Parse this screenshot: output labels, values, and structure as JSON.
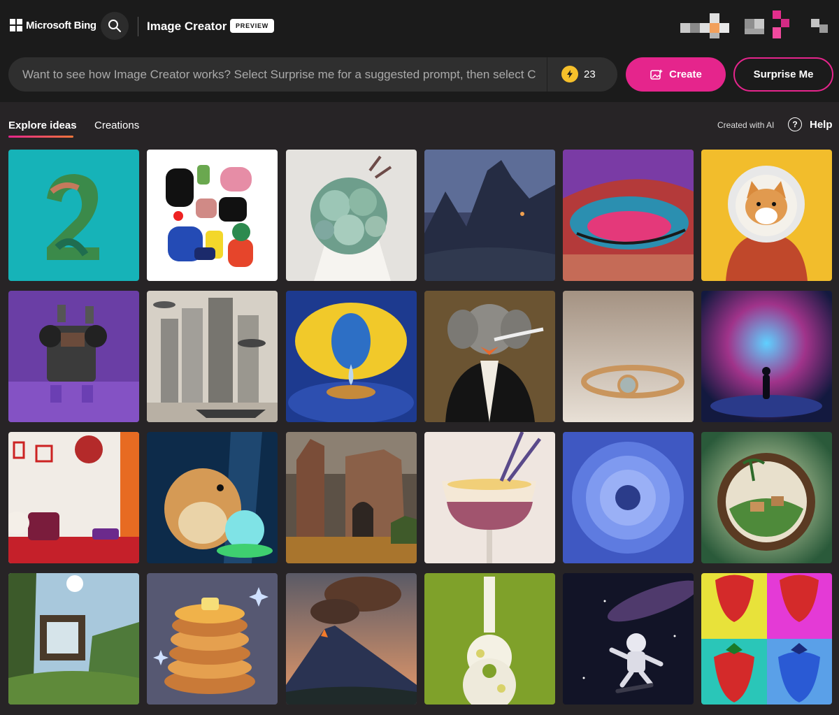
{
  "header": {
    "brand": "Microsoft Bing",
    "app_title": "Image Creator",
    "badge": "PREVIEW",
    "search_icon": "search-icon",
    "logo_icon": "microsoft-logo-icon"
  },
  "prompt": {
    "placeholder": "Want to see how Image Creator works? Select Surprise me for a suggested prompt, then select C",
    "boosts": "23",
    "boost_icon": "lightning-bolt-icon",
    "create_label": "Create",
    "create_icon": "image-sparkle-icon",
    "surprise_label": "Surprise Me"
  },
  "tabs": {
    "explore": "Explore ideas",
    "creations": "Creations"
  },
  "meta": {
    "created_with_ai": "Created with AI",
    "help": "Help",
    "help_icon": "help-circle-icon"
  },
  "colors": {
    "accent": "#e5258c",
    "background": "#272426",
    "header": "#1b1b1b",
    "boost": "#f6c02b"
  },
  "gallery": [
    {
      "subject": "number-two-collage",
      "bg": "#16b3b8"
    },
    {
      "subject": "abstract-shapes",
      "bg": "#ffffff"
    },
    {
      "subject": "succulent-bouquet",
      "bg": "#e4e2de"
    },
    {
      "subject": "dark-castle-mountains",
      "bg": "#3c4466"
    },
    {
      "subject": "glitter-eyeshadow",
      "bg": "#c23a3a"
    },
    {
      "subject": "shiba-astronaut",
      "bg": "#f2bd2c"
    },
    {
      "subject": "robot-speakers",
      "bg": "#6a3ea5"
    },
    {
      "subject": "futuristic-city",
      "bg": "#cfc8bd"
    },
    {
      "subject": "lemon-droplet",
      "bg": "#1e3a8f"
    },
    {
      "subject": "elephant-tuxedo",
      "bg": "#6b5432"
    },
    {
      "subject": "gold-ring",
      "bg": "#b5a08e"
    },
    {
      "subject": "nebula-figure",
      "bg": "#1e2a6e"
    },
    {
      "subject": "cozy-room",
      "bg": "#f1ece6"
    },
    {
      "subject": "hamster-crystal-ball",
      "bg": "#0d2b4a"
    },
    {
      "subject": "ruined-castle-painting",
      "bg": "#5c5146"
    },
    {
      "subject": "cocktail-lavender",
      "bg": "#efe6e0"
    },
    {
      "subject": "blue-dahlia",
      "bg": "#3f58c2"
    },
    {
      "subject": "coconut-village",
      "bg": "#3a6c4c"
    },
    {
      "subject": "treehouse-cabin",
      "bg": "#6f9ab0"
    },
    {
      "subject": "pancake-stack",
      "bg": "#565872"
    },
    {
      "subject": "volcano-eruption",
      "bg": "#4e4e5b"
    },
    {
      "subject": "flower-guitar",
      "bg": "#7fa12a"
    },
    {
      "subject": "space-skater",
      "bg": "#121427"
    },
    {
      "subject": "strawberry-pop-art",
      "bg": "#e8e23a"
    }
  ]
}
